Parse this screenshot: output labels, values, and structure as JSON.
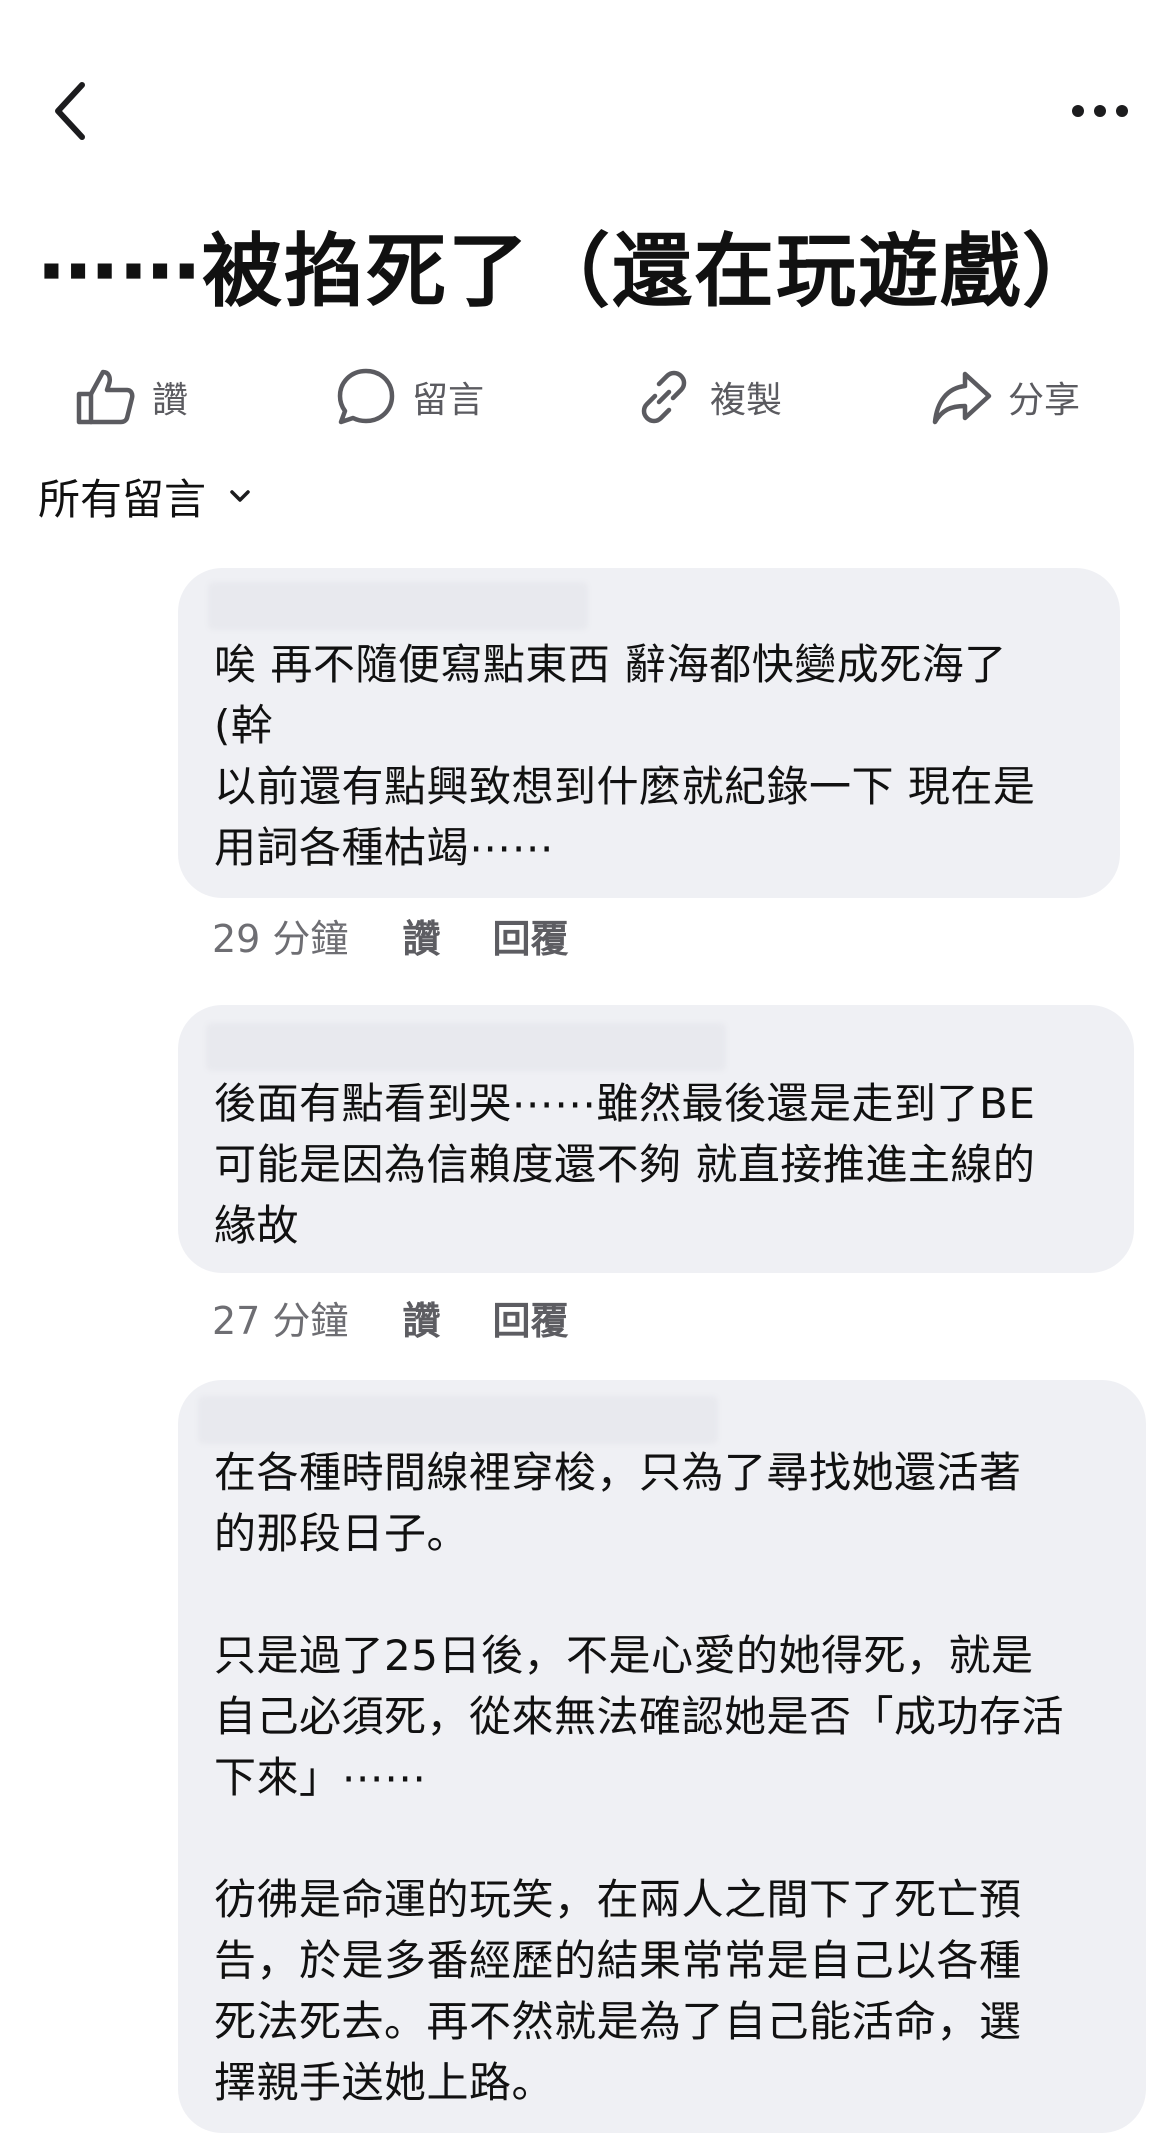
{
  "header": {
    "back_icon": "chevron-left-icon",
    "more_icon": "more-horizontal-icon"
  },
  "post": {
    "title": "⋯⋯被掐死了（還在玩遊戲）"
  },
  "actions": [
    {
      "label": "讚",
      "icon": "thumbs-up-icon"
    },
    {
      "label": "留言",
      "icon": "comment-bubble-icon"
    },
    {
      "label": "複製",
      "icon": "link-icon"
    },
    {
      "label": "分享",
      "icon": "share-arrow-icon"
    }
  ],
  "filter": {
    "label": "所有留言",
    "icon": "chevron-down-icon"
  },
  "comments": [
    {
      "text": "唉 再不隨便寫點東西 辭海都快變成死海了\n(幹\n以前還有點興致想到什麼就紀錄一下 現在是\n用詞各種枯竭⋯⋯",
      "time": "29 分鐘",
      "like": "讚",
      "reply": "回覆"
    },
    {
      "text": "後面有點看到哭⋯⋯雖然最後還是走到了BE\n可能是因為信賴度還不夠 就直接推進主線的\n緣故",
      "time": "27 分鐘",
      "like": "讚",
      "reply": "回覆"
    },
    {
      "text": "在各種時間線裡穿梭，只為了尋找她還活著\n的那段日子。\n\n只是過了25日後，不是心愛的她得死，就是\n自己必須死，從來無法確認她是否「成功存活\n下來」⋯⋯\n\n彷彿是命運的玩笑，在兩人之間下了死亡預\n告，於是多番經歷的結果常常是自己以各種\n死法死去。再不然就是為了自己能活命，選\n擇親手送她上路。"
    }
  ],
  "colors": {
    "bubble_bg": "#eff0f4",
    "text_primary": "#111111",
    "text_secondary": "#6e6e73"
  }
}
